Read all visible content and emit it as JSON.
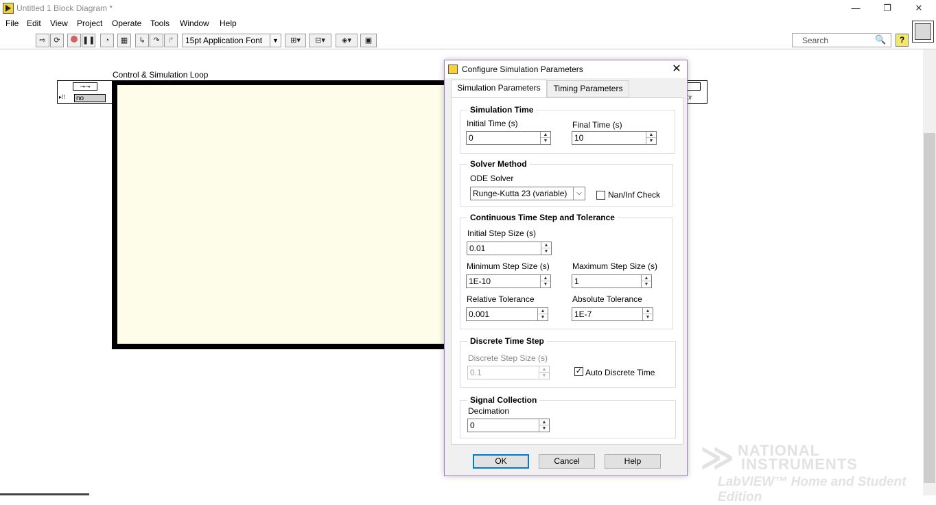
{
  "window": {
    "title": "Untitled 1 Block Diagram *",
    "minimize": "—",
    "restore": "❐",
    "close": "✕"
  },
  "menu": [
    "File",
    "Edit",
    "View",
    "Project",
    "Operate",
    "Tools",
    "Window",
    "Help"
  ],
  "toolbar": {
    "font": "15pt Application Font",
    "search_placeholder": "Search",
    "help": "?"
  },
  "diagram": {
    "loop_label": "Control & Simulation Loop",
    "input_terminal_value": "no",
    "output_terminal_value": "or"
  },
  "watermark": {
    "line1": "NATIONAL",
    "line2": "INSTRUMENTS",
    "line3": "LabVIEW™ Home and Student Edition"
  },
  "dialog": {
    "title": "Configure Simulation Parameters",
    "close": "✕",
    "tabs": [
      {
        "label": "Simulation Parameters",
        "active": true
      },
      {
        "label": "Timing Parameters",
        "active": false
      }
    ],
    "simulation_time": {
      "title": "Simulation Time",
      "initial_label": "Initial Time (s)",
      "initial_value": "0",
      "final_label": "Final Time (s)",
      "final_value": "10"
    },
    "solver_method": {
      "title": "Solver Method",
      "ode_label": "ODE Solver",
      "ode_value": "Runge-Kutta 23 (variable)",
      "nan_check_label": "Nan/Inf Check",
      "nan_check_checked": false
    },
    "continuous": {
      "title": "Continuous Time Step and Tolerance",
      "initial_step_label": "Initial Step Size (s)",
      "initial_step_value": "0.01",
      "min_step_label": "Minimum Step Size (s)",
      "min_step_value": "1E-10",
      "max_step_label": "Maximum Step Size (s)",
      "max_step_value": "1",
      "rel_tol_label": "Relative Tolerance",
      "rel_tol_value": "0.001",
      "abs_tol_label": "Absolute Tolerance",
      "abs_tol_value": "1E-7"
    },
    "discrete": {
      "title": "Discrete Time Step",
      "step_label": "Discrete Step Size (s)",
      "step_value": "0.1",
      "auto_label": "Auto Discrete Time",
      "auto_checked": true
    },
    "signal": {
      "title": "Signal Collection",
      "decimation_label": "Decimation",
      "decimation_value": "0"
    },
    "buttons": {
      "ok": "OK",
      "cancel": "Cancel",
      "help": "Help"
    }
  }
}
